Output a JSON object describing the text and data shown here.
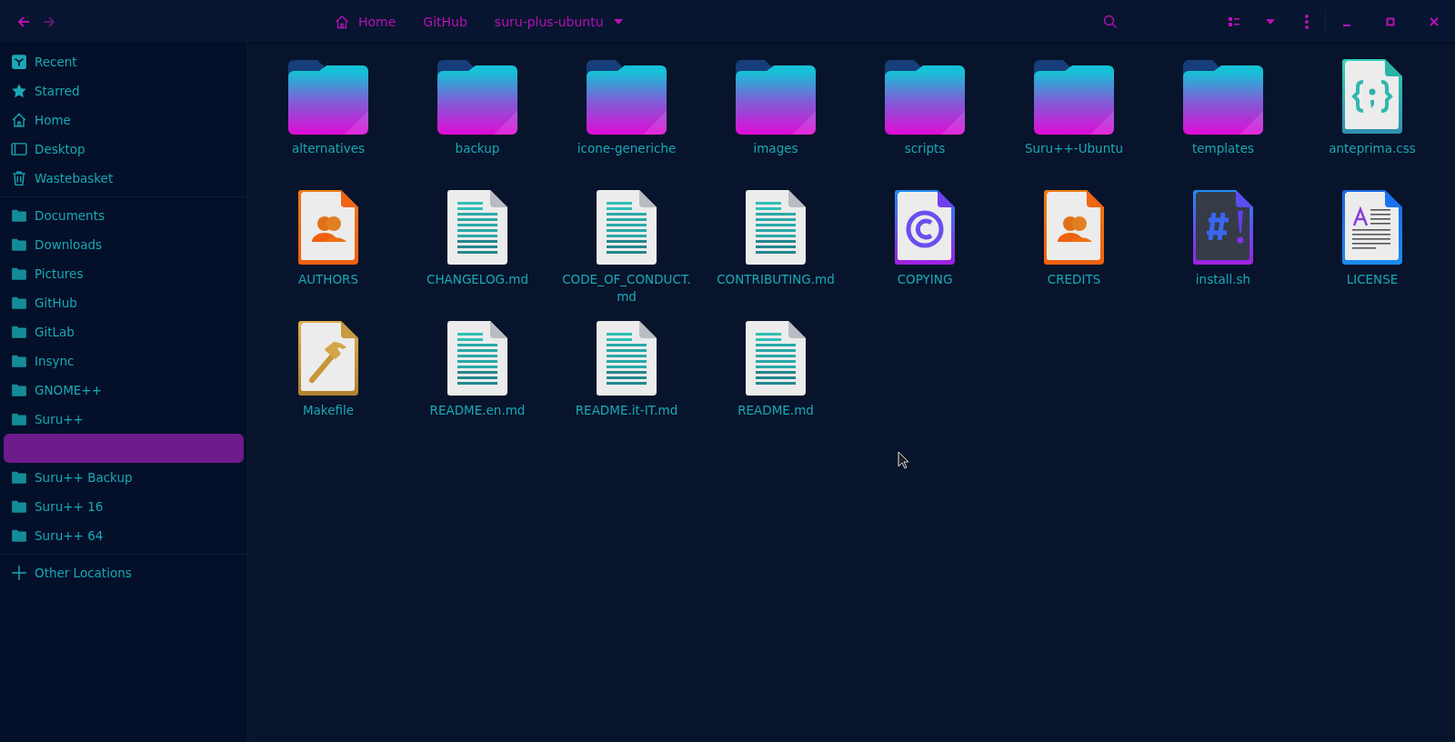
{
  "header": {
    "crumbs": [
      {
        "label": "Home",
        "kind": "home"
      },
      {
        "label": "GitHub",
        "kind": "plain"
      },
      {
        "label": "suru-plus-ubuntu",
        "kind": "menu"
      }
    ]
  },
  "sidebar": {
    "groups": [
      [
        {
          "label": "Recent",
          "kind": "recent"
        },
        {
          "label": "Starred",
          "kind": "starred"
        },
        {
          "label": "Home",
          "kind": "home"
        },
        {
          "label": "Desktop",
          "kind": "desktop"
        },
        {
          "label": "Wastebasket",
          "kind": "trash"
        }
      ],
      [
        {
          "label": "Documents",
          "kind": "folder"
        },
        {
          "label": "Downloads",
          "kind": "folder"
        },
        {
          "label": "Pictures",
          "kind": "folder"
        },
        {
          "label": "GitHub",
          "kind": "folder"
        },
        {
          "label": "GitLab",
          "kind": "folder"
        },
        {
          "label": "Insync",
          "kind": "folder"
        },
        {
          "label": "GNOME++",
          "kind": "folder"
        },
        {
          "label": "Suru++",
          "kind": "folder"
        },
        {
          "kind": "drop-target"
        },
        {
          "label": "Suru++ Backup",
          "kind": "folder"
        },
        {
          "label": "Suru++ 16",
          "kind": "folder"
        },
        {
          "label": "Suru++ 64",
          "kind": "folder"
        }
      ],
      [
        {
          "label": "Other Locations",
          "kind": "other"
        }
      ]
    ]
  },
  "files": [
    {
      "name": "alternatives",
      "kind": "folder"
    },
    {
      "name": "backup",
      "kind": "folder"
    },
    {
      "name": "icone-generiche",
      "kind": "folder"
    },
    {
      "name": "images",
      "kind": "folder"
    },
    {
      "name": "scripts",
      "kind": "folder"
    },
    {
      "name": "Suru++-Ubuntu",
      "kind": "folder"
    },
    {
      "name": "templates",
      "kind": "folder"
    },
    {
      "name": "anteprima.css",
      "kind": "css"
    },
    {
      "name": "AUTHORS",
      "kind": "people"
    },
    {
      "name": "CHANGELOG.md",
      "kind": "text"
    },
    {
      "name": "CODE_OF_CONDUCT.md",
      "kind": "text"
    },
    {
      "name": "CONTRIBUTING.md",
      "kind": "text"
    },
    {
      "name": "COPYING",
      "kind": "copyright"
    },
    {
      "name": "CREDITS",
      "kind": "people"
    },
    {
      "name": "install.sh",
      "kind": "script"
    },
    {
      "name": "LICENSE",
      "kind": "license"
    },
    {
      "name": "Makefile",
      "kind": "makefile"
    },
    {
      "name": "README.en.md",
      "kind": "text"
    },
    {
      "name": "README.it-IT.md",
      "kind": "text"
    },
    {
      "name": "README.md",
      "kind": "text"
    }
  ]
}
